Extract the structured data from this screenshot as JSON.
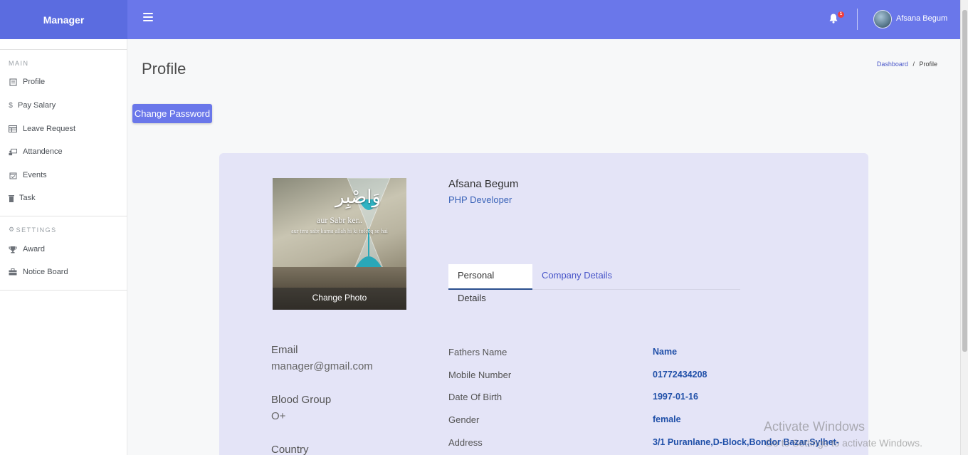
{
  "brand": "Manager",
  "topbar": {
    "notification_count": "1",
    "user_name": "Afsana Begum"
  },
  "sidebar": {
    "main_heading": "MAIN",
    "main_items": [
      {
        "label": "Profile",
        "icon": "profile-icon"
      },
      {
        "label": "Pay Salary",
        "icon": "dollar-icon"
      },
      {
        "label": "Leave Request",
        "icon": "table-icon"
      },
      {
        "label": "Attandence",
        "icon": "attendance-icon"
      },
      {
        "label": "Events",
        "icon": "calendar-check-icon"
      },
      {
        "label": "Task",
        "icon": "trash-icon"
      }
    ],
    "settings_heading": "SETTINGS",
    "settings_items": [
      {
        "label": "Award",
        "icon": "trophy-icon"
      },
      {
        "label": "Notice Board",
        "icon": "briefcase-icon"
      }
    ]
  },
  "page": {
    "title": "Profile",
    "breadcrumb_link": "Dashboard",
    "breadcrumb_sep": "/",
    "breadcrumb_current": "Profile",
    "change_password": "Change Password"
  },
  "profile": {
    "photo_line1": "aur Sabr ker..",
    "photo_line2": "aur tera sabr karna allah hi ki tofeeq se hai",
    "change_photo": "Change Photo",
    "name": "Afsana Begum",
    "role": "PHP Developer",
    "tabs": [
      "Personal Details",
      "Company Details"
    ],
    "left_fields": [
      {
        "label": "Email",
        "value": "manager@gmail.com"
      },
      {
        "label": "Blood Group",
        "value": "O+"
      },
      {
        "label": "Country",
        "value": ""
      }
    ],
    "details": [
      {
        "key": "Fathers Name",
        "value": "Name"
      },
      {
        "key": "Mobile Number",
        "value": "01772434208"
      },
      {
        "key": "Date Of Birth",
        "value": "1997-01-16"
      },
      {
        "key": "Gender",
        "value": "female"
      },
      {
        "key": "Address",
        "value": "3/1 Puranlane,D-Block,Bondor Bazar,Sylhet-"
      }
    ]
  },
  "watermark": {
    "line1": "Activate Windows",
    "line2": "Go to Settings to activate Windows."
  },
  "colors": {
    "accent": "#6a77ea",
    "brand_bg": "#5b6ce0",
    "card_bg": "#e4e4f7",
    "link": "#1f4fa8"
  }
}
